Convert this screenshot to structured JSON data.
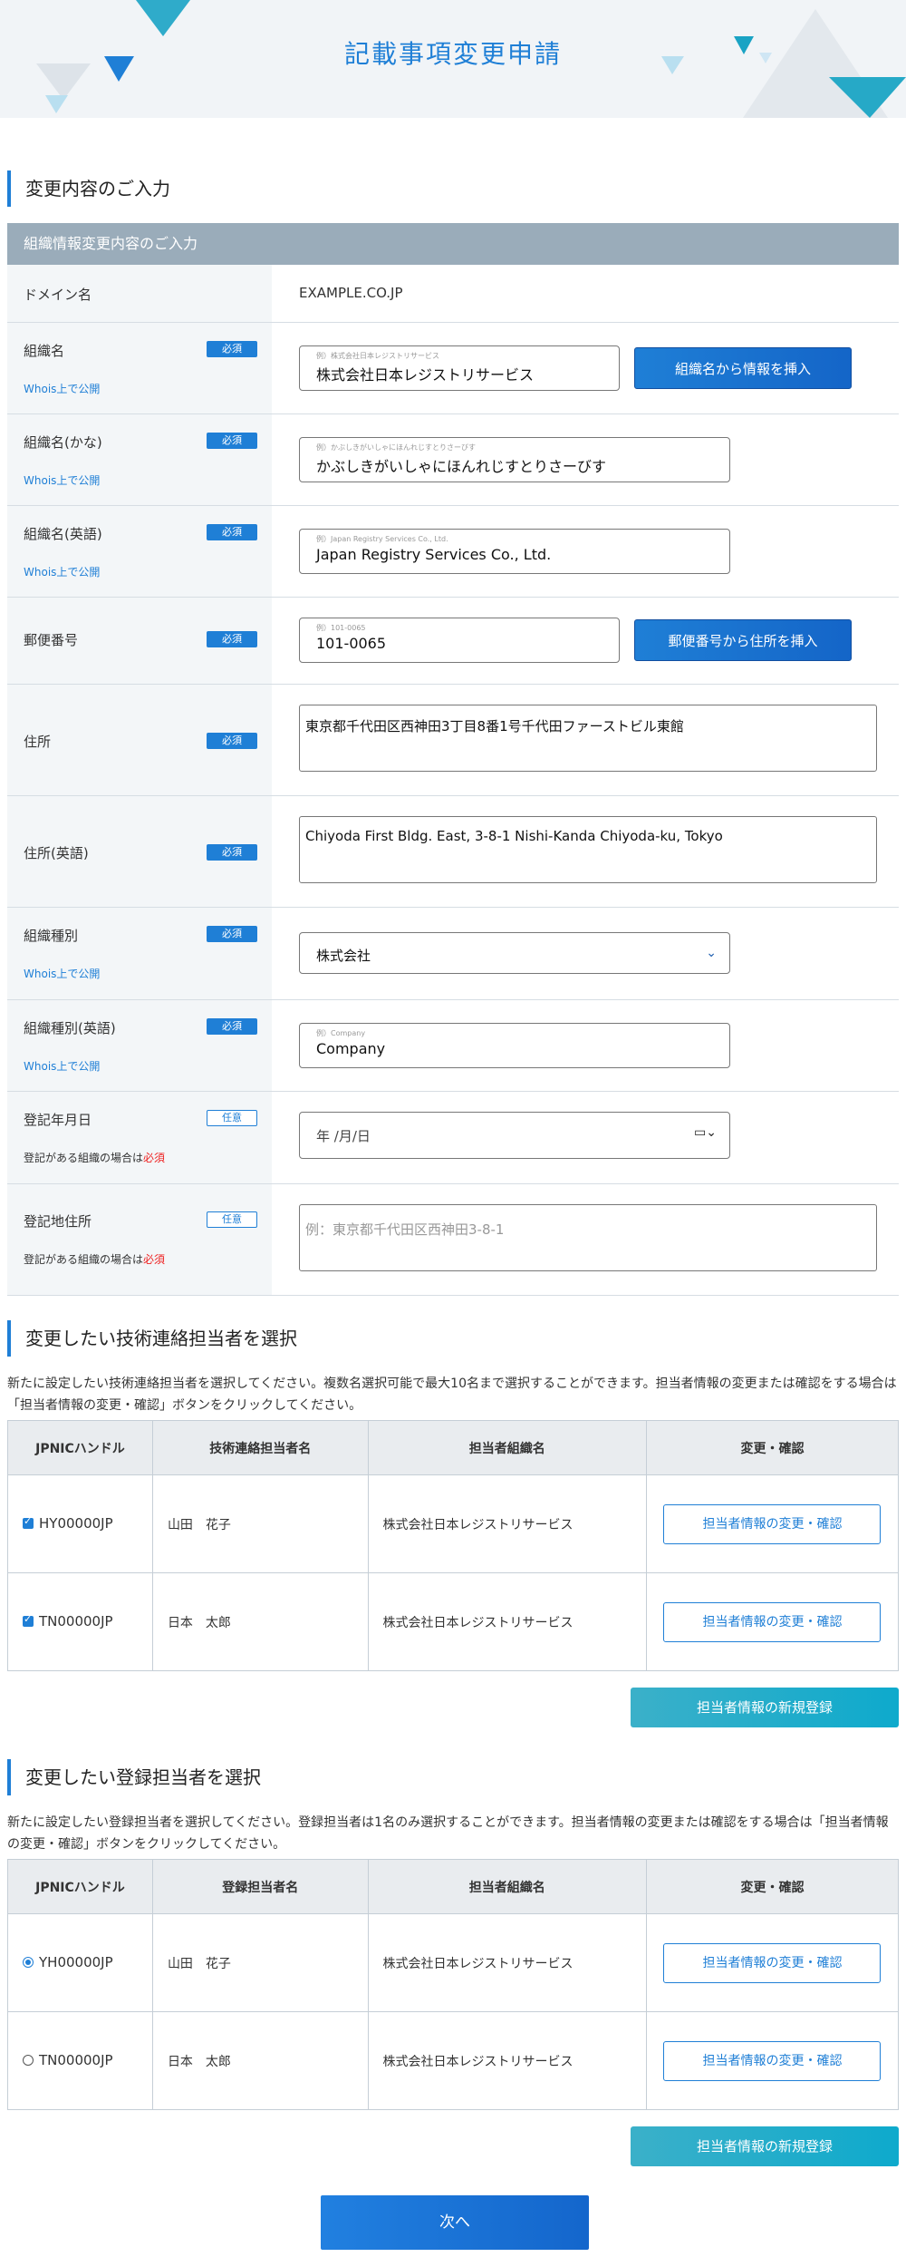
{
  "banner": {
    "title": "記載事項変更申請"
  },
  "section_input": {
    "title": "変更内容のご入力",
    "subtitle": "組織情報変更内容のご入力"
  },
  "common": {
    "required": "必須",
    "optional": "任意",
    "whois": "Whois上で公開",
    "note_prefix": "登記がある組織の場合は",
    "note_required": "必須"
  },
  "form": {
    "domain": {
      "label": "ドメイン名",
      "value": "EXAMPLE.CO.JP"
    },
    "org_name": {
      "label": "組織名",
      "placeholder": "例）株式会社日本レジストリサービス",
      "value": "株式会社日本レジストリサービス",
      "button": "組織名から情報を挿入"
    },
    "org_kana": {
      "label": "組織名(かな)",
      "placeholder": "例）かぶしきがいしゃにほんれじすとりさーびす",
      "value": "かぶしきがいしゃにほんれじすとりさーびす"
    },
    "org_en": {
      "label": "組織名(英語)",
      "placeholder": "例）Japan Registry Services Co., Ltd.",
      "value": "Japan Registry Services Co., Ltd."
    },
    "postal": {
      "label": "郵便番号",
      "placeholder": "例）101-0065",
      "value": "101-0065",
      "button": "郵便番号から住所を挿入"
    },
    "address": {
      "label": "住所",
      "value": "東京都千代田区西神田3丁目8番1号千代田ファーストビル東館"
    },
    "address_en": {
      "label": "住所(英語)",
      "value": "Chiyoda First Bldg. East, 3-8-1 Nishi-Kanda Chiyoda-ku, Tokyo"
    },
    "org_type": {
      "label": "組織種別",
      "value": "株式会社"
    },
    "org_type_en": {
      "label": "組織種別(英語)",
      "placeholder": "例）Company",
      "value": "Company"
    },
    "reg_date": {
      "label": "登記年月日",
      "value": "年 /月/日"
    },
    "reg_address": {
      "label": "登記地住所",
      "placeholder": "例：東京都千代田区西神田3-8-1"
    }
  },
  "tech": {
    "title": "変更したい技術連絡担当者を選択",
    "description": "新たに設定したい技術連絡担当者を選択してください。複数名選択可能で最大10名まで選択することができます。担当者情報の変更または確認をする場合は「担当者情報の変更・確認」ボタンをクリックしてください。",
    "headers": [
      "JPNICハンドル",
      "技術連絡担当者名",
      "担当者組織名",
      "変更・確認"
    ],
    "rows": [
      {
        "handle": "HY00000JP",
        "name": "山田　花子",
        "org": "株式会社日本レジストリサービス",
        "button": "担当者情報の変更・確認"
      },
      {
        "handle": "TN00000JP",
        "name": "日本　太郎",
        "org": "株式会社日本レジストリサービス",
        "button": "担当者情報の変更・確認"
      }
    ],
    "new_button": "担当者情報の新規登録"
  },
  "reg": {
    "title": "変更したい登録担当者を選択",
    "description": "新たに設定したい登録担当者を選択してください。登録担当者は1名のみ選択することができます。担当者情報の変更または確認をする場合は「担当者情報の変更・確認」ボタンをクリックしてください。",
    "headers": [
      "JPNICハンドル",
      "登録担当者名",
      "担当者組織名",
      "変更・確認"
    ],
    "rows": [
      {
        "handle": "YH00000JP",
        "name": "山田　花子",
        "org": "株式会社日本レジストリサービス",
        "button": "担当者情報の変更・確認"
      },
      {
        "handle": "TN00000JP",
        "name": "日本　太郎",
        "org": "株式会社日本レジストリサービス",
        "button": "担当者情報の変更・確認"
      }
    ],
    "new_button": "担当者情報の新規登録"
  },
  "next_button": "次へ",
  "colors": {
    "primary": "#1f7fd6",
    "teal": "#0eaacc",
    "subheader": "#9aacba",
    "required_red": "#e22222"
  }
}
